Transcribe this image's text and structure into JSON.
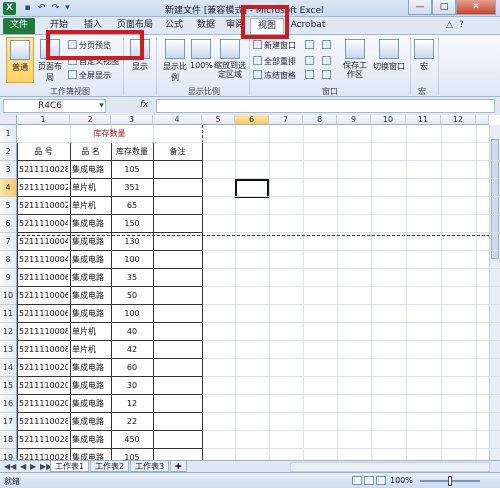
{
  "titlebar": {
    "title": "新建文件 [兼容模式] - Microsoft Excel",
    "minimize": "—",
    "maximize": "□",
    "close": "✕"
  },
  "tabs": [
    "文件",
    "开始",
    "插入",
    "页面布局",
    "公式",
    "数据",
    "审阅",
    "视图",
    "Acrobat"
  ],
  "active_tab": "视图",
  "ribbon": {
    "workbook_views": {
      "normal": "普通",
      "page_layout": "页面布局",
      "page_break_preview": "分页预览",
      "custom_views": "自定义视图",
      "full_screen": "全屏显示",
      "group_label": "工作簿视图"
    },
    "show": {
      "label": "显示"
    },
    "zoom": {
      "zoom": "显示比例",
      "hundred": "100%",
      "zoom_selection": "缩放到选定区域",
      "group_label": "显示比例"
    },
    "window": {
      "new_window": "新建窗口",
      "arrange_all": "全部重排",
      "freeze_panes": "冻结窗格",
      "save_workspace": "保存工作区",
      "switch_windows": "切换窗口",
      "group_label": "窗口"
    },
    "macros": {
      "macros": "宏",
      "group_label": "宏"
    }
  },
  "formula_bar": {
    "name_box": "R4C6",
    "fx": "fx",
    "value": ""
  },
  "columns": [
    "1",
    "2",
    "3",
    "4",
    "5",
    "6",
    "7",
    "8",
    "9",
    "10",
    "11",
    "12"
  ],
  "selected_column": "6",
  "rows": [
    "1",
    "2",
    "3",
    "4",
    "5",
    "6",
    "7",
    "8",
    "9",
    "10",
    "11",
    "12",
    "13",
    "14",
    "15",
    "16",
    "17",
    "18",
    "19"
  ],
  "selected_row": "4",
  "table": {
    "title": "库存数量",
    "headers": [
      "品  号",
      "品  名",
      "库存数量",
      "备注"
    ],
    "data": [
      [
        "5211110028",
        "集成电路",
        "105",
        ""
      ],
      [
        "5211110002",
        "单片机",
        "351",
        ""
      ],
      [
        "5211110002",
        "单片机",
        "65",
        ""
      ],
      [
        "5211110004",
        "集成电路",
        "150",
        ""
      ],
      [
        "5211110004",
        "集成电路",
        "130",
        ""
      ],
      [
        "5211110004",
        "集成电路",
        "100",
        ""
      ],
      [
        "5211110006",
        "集成电路",
        "35",
        ""
      ],
      [
        "5211110006",
        "集成电路",
        "50",
        ""
      ],
      [
        "5211110006",
        "集成电路",
        "100",
        ""
      ],
      [
        "5211110008",
        "单片机",
        "40",
        ""
      ],
      [
        "5211110008",
        "单片机",
        "42",
        ""
      ],
      [
        "5211110020",
        "集成电路",
        "60",
        ""
      ],
      [
        "5211110020",
        "集成电路",
        "30",
        ""
      ],
      [
        "5211110020",
        "集成电路",
        "12",
        ""
      ],
      [
        "5211110028",
        "集成电路",
        "22",
        ""
      ],
      [
        "5211110028",
        "集成电路",
        "450",
        ""
      ],
      [
        "5211110028",
        "集成电路",
        "105",
        ""
      ]
    ]
  },
  "sheets": [
    "工作表1",
    "工作表2",
    "工作表3"
  ],
  "active_sheet": "工作表1",
  "status": {
    "ready": "就绪",
    "zoom": "100%"
  },
  "colors": {
    "title_text": "#c0141a",
    "file_tab": "#1f7a3d",
    "highlight_box": "#d41b1b"
  }
}
